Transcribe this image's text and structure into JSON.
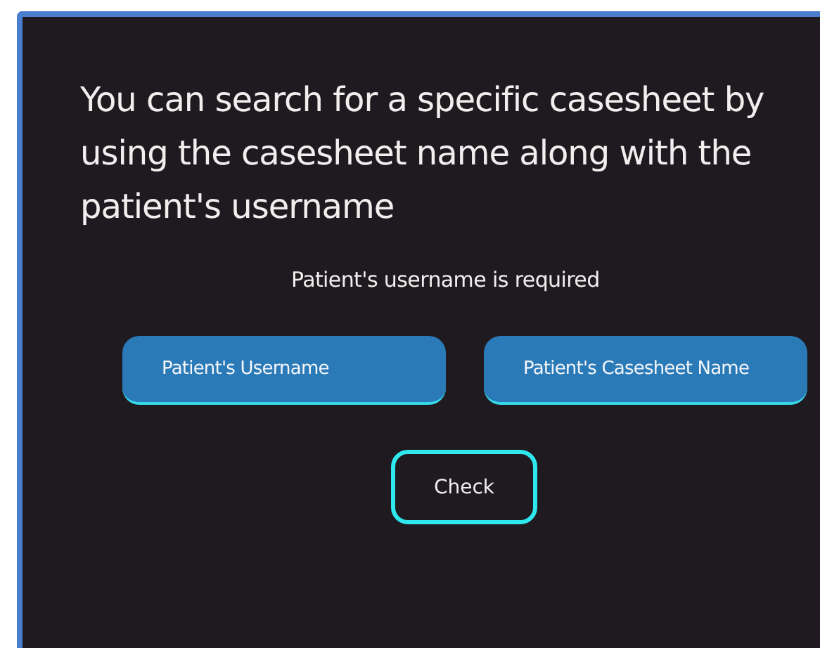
{
  "heading": "You can search for a specific casesheet by using the casesheet name along with the patient's username",
  "message": "Patient's username is required",
  "fields": [
    {
      "placeholder": "Patient's Username"
    },
    {
      "placeholder": "Patient's Casesheet Name"
    }
  ],
  "button": "Check"
}
